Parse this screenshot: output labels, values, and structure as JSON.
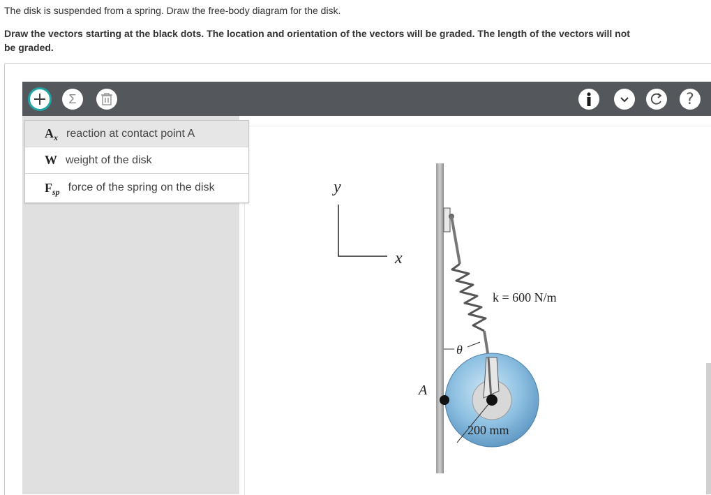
{
  "prompt": "The disk is suspended from a spring. Draw the free-body diagram for the disk.",
  "instructions": "Draw the vectors starting at the black dots. The location and orientation of the vectors will be graded. The length of the vectors will not be graded.",
  "toolbar": {
    "add_icon": "plus-icon",
    "sum_icon": "sigma-icon",
    "sum_glyph": "Σ",
    "delete_icon": "trash-icon",
    "info_icon": "info-icon",
    "chevron_icon": "chevron-down-icon",
    "reset_icon": "reset-icon",
    "help_glyph": "?",
    "accent_color": "#21a6a6",
    "bar_color": "#54585c"
  },
  "vectors": [
    {
      "symbol": "A",
      "subscript": "x",
      "label": "reaction at contact point A"
    },
    {
      "symbol": "W",
      "subscript": "",
      "label": "weight of the disk"
    },
    {
      "symbol": "F",
      "subscript": "sp",
      "label": "force of the spring on the disk"
    }
  ],
  "diagram": {
    "axis_y": "y",
    "axis_x": "x",
    "spring_label": "k = 600 N/m",
    "angle_label": "θ",
    "point_label": "A",
    "radius_label": "200 mm"
  }
}
